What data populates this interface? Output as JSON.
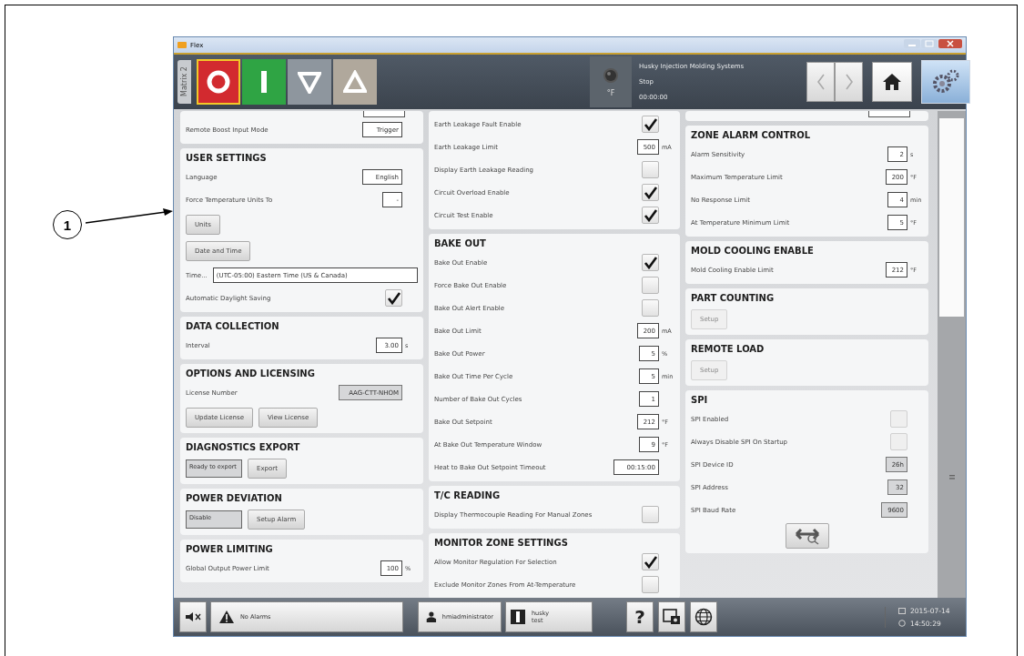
{
  "callout": {
    "label": "1"
  },
  "window": {
    "title": "Flex"
  },
  "toolbar": {
    "tab": "Matrix 2",
    "modes": [
      {
        "kind": "stop",
        "selected": true
      },
      {
        "kind": "start",
        "selected": false
      },
      {
        "kind": "down",
        "selected": false
      },
      {
        "kind": "up",
        "selected": false
      }
    ],
    "status": {
      "unit": "°F",
      "company": "Husky Injection Molding Systems",
      "state": "Stop",
      "time": "00:00:00"
    }
  },
  "columns": [
    {
      "sections": [
        {
          "cut_top": true,
          "rows": [
            {
              "kind": "field",
              "label": "Remote Boost Input Mode",
              "value": "Trigger"
            }
          ]
        },
        {
          "title": "USER SETTINGS",
          "rows": [
            {
              "kind": "field",
              "label": "Language",
              "value": "English"
            },
            {
              "kind": "field",
              "label": "Force Temperature Units To",
              "value": "-"
            },
            {
              "kind": "buttons",
              "buttons": [
                {
                  "label": "Units"
                }
              ]
            },
            {
              "kind": "buttons",
              "buttons": [
                {
                  "label": "Date and Time"
                }
              ]
            },
            {
              "kind": "wide",
              "label": "Time...",
              "value": "(UTC-05:00) Eastern Time (US & Canada)"
            },
            {
              "kind": "check",
              "label": "Automatic Daylight Saving",
              "checked": true
            }
          ]
        },
        {
          "title": "DATA COLLECTION",
          "rows": [
            {
              "kind": "field",
              "label": "Interval",
              "value": "3.00",
              "unit": "s"
            }
          ]
        },
        {
          "title": "OPTIONS AND LICENSING",
          "rows": [
            {
              "kind": "field",
              "label": "License Number",
              "value": "AAG-CTT-NHOM",
              "disabled": true
            },
            {
              "kind": "buttons",
              "buttons": [
                {
                  "label": "Update License"
                },
                {
                  "label": "View License"
                }
              ]
            }
          ]
        },
        {
          "title": "DIAGNOSTICS EXPORT",
          "rows": [
            {
              "kind": "status",
              "value": "Ready to export",
              "buttons": [
                {
                  "label": "Export"
                }
              ]
            }
          ]
        },
        {
          "title": "POWER DEVIATION",
          "rows": [
            {
              "kind": "status",
              "value": "Disable",
              "buttons": [
                {
                  "label": "Setup Alarm"
                }
              ]
            }
          ]
        },
        {
          "title": "POWER LIMITING",
          "rows": [
            {
              "kind": "field",
              "label": "Global Output Power Limit",
              "value": "100",
              "unit": "%"
            }
          ]
        }
      ]
    },
    {
      "sections": [
        {
          "rows": [
            {
              "kind": "check",
              "label": "Earth Leakage Fault Enable",
              "checked": true
            },
            {
              "kind": "field",
              "label": "Earth Leakage Limit",
              "value": "500",
              "unit": "mA"
            },
            {
              "kind": "check",
              "label": "Display Earth Leakage Reading",
              "checked": false
            },
            {
              "kind": "check",
              "label": "Circuit Overload Enable",
              "checked": true
            },
            {
              "kind": "check",
              "label": "Circuit Test Enable",
              "checked": true
            }
          ]
        },
        {
          "title": "BAKE OUT",
          "rows": [
            {
              "kind": "check",
              "label": "Bake Out Enable",
              "checked": true
            },
            {
              "kind": "check",
              "label": "Force Bake Out Enable",
              "checked": false
            },
            {
              "kind": "check",
              "label": "Bake Out Alert Enable",
              "checked": false
            },
            {
              "kind": "field",
              "label": "Bake Out Limit",
              "value": "200",
              "unit": "mA"
            },
            {
              "kind": "field",
              "label": "Bake Out Power",
              "value": "5",
              "unit": "%"
            },
            {
              "kind": "field",
              "label": "Bake Out Time Per Cycle",
              "value": "5",
              "unit": "min"
            },
            {
              "kind": "field",
              "label": "Number of Bake Out Cycles",
              "value": "1"
            },
            {
              "kind": "field",
              "label": "Bake Out Setpoint",
              "value": "212",
              "unit": "°F"
            },
            {
              "kind": "field",
              "label": "At Bake Out Temperature Window",
              "value": "9",
              "unit": "°F"
            },
            {
              "kind": "field",
              "label": "Heat to Bake Out Setpoint Timeout",
              "value": "00:15:00"
            }
          ]
        },
        {
          "title": "T/C READING",
          "rows": [
            {
              "kind": "check",
              "label": "Display Thermocouple Reading For Manual Zones",
              "checked": false
            }
          ]
        },
        {
          "title": "MONITOR ZONE SETTINGS",
          "rows": [
            {
              "kind": "check",
              "label": "Allow Monitor Regulation For Selection",
              "checked": true
            },
            {
              "kind": "check",
              "label": "Exclude Monitor Zones From At-Temperature",
              "checked": false
            }
          ]
        }
      ]
    },
    {
      "sections": [
        {
          "cut_top": true
        },
        {
          "title": "ZONE ALARM CONTROL",
          "rows": [
            {
              "kind": "field",
              "label": "Alarm Sensitivity",
              "value": "2",
              "unit": "s"
            },
            {
              "kind": "field",
              "label": "Maximum Temperature Limit",
              "value": "200",
              "unit": "°F"
            },
            {
              "kind": "field",
              "label": "No Response Limit",
              "value": "4",
              "unit": "min"
            },
            {
              "kind": "field",
              "label": "At Temperature Minimum Limit",
              "value": "5",
              "unit": "°F"
            }
          ]
        },
        {
          "title": "MOLD COOLING ENABLE",
          "rows": [
            {
              "kind": "field",
              "label": "Mold Cooling Enable Limit",
              "value": "212",
              "unit": "°F"
            }
          ]
        },
        {
          "title": "PART COUNTING",
          "rows": [
            {
              "kind": "buttons",
              "buttons": [
                {
                  "label": "Setup",
                  "disabled": true
                }
              ]
            }
          ]
        },
        {
          "title": "REMOTE LOAD",
          "rows": [
            {
              "kind": "buttons",
              "buttons": [
                {
                  "label": "Setup",
                  "disabled": true
                }
              ]
            }
          ]
        },
        {
          "title": "SPI",
          "rows": [
            {
              "kind": "check",
              "label": "SPI Enabled",
              "checked": false,
              "disabled": true
            },
            {
              "kind": "check",
              "label": "Always Disable SPI On Startup",
              "checked": false,
              "disabled": true
            },
            {
              "kind": "field",
              "label": "SPI Device ID",
              "value": "26h",
              "disabled": true
            },
            {
              "kind": "field",
              "label": "SPI Address",
              "value": "32",
              "disabled": true
            },
            {
              "kind": "field",
              "label": "SPI Baud Rate",
              "value": "9600",
              "disabled": true
            },
            {
              "kind": "icon_button"
            }
          ]
        }
      ]
    }
  ],
  "status_bar": {
    "alarms": "No Alarms",
    "user": "hmiadministrator",
    "machine": "husky",
    "machine_sub": "test",
    "help": "?",
    "date": "2015-07-14",
    "time": "14:50:29"
  }
}
